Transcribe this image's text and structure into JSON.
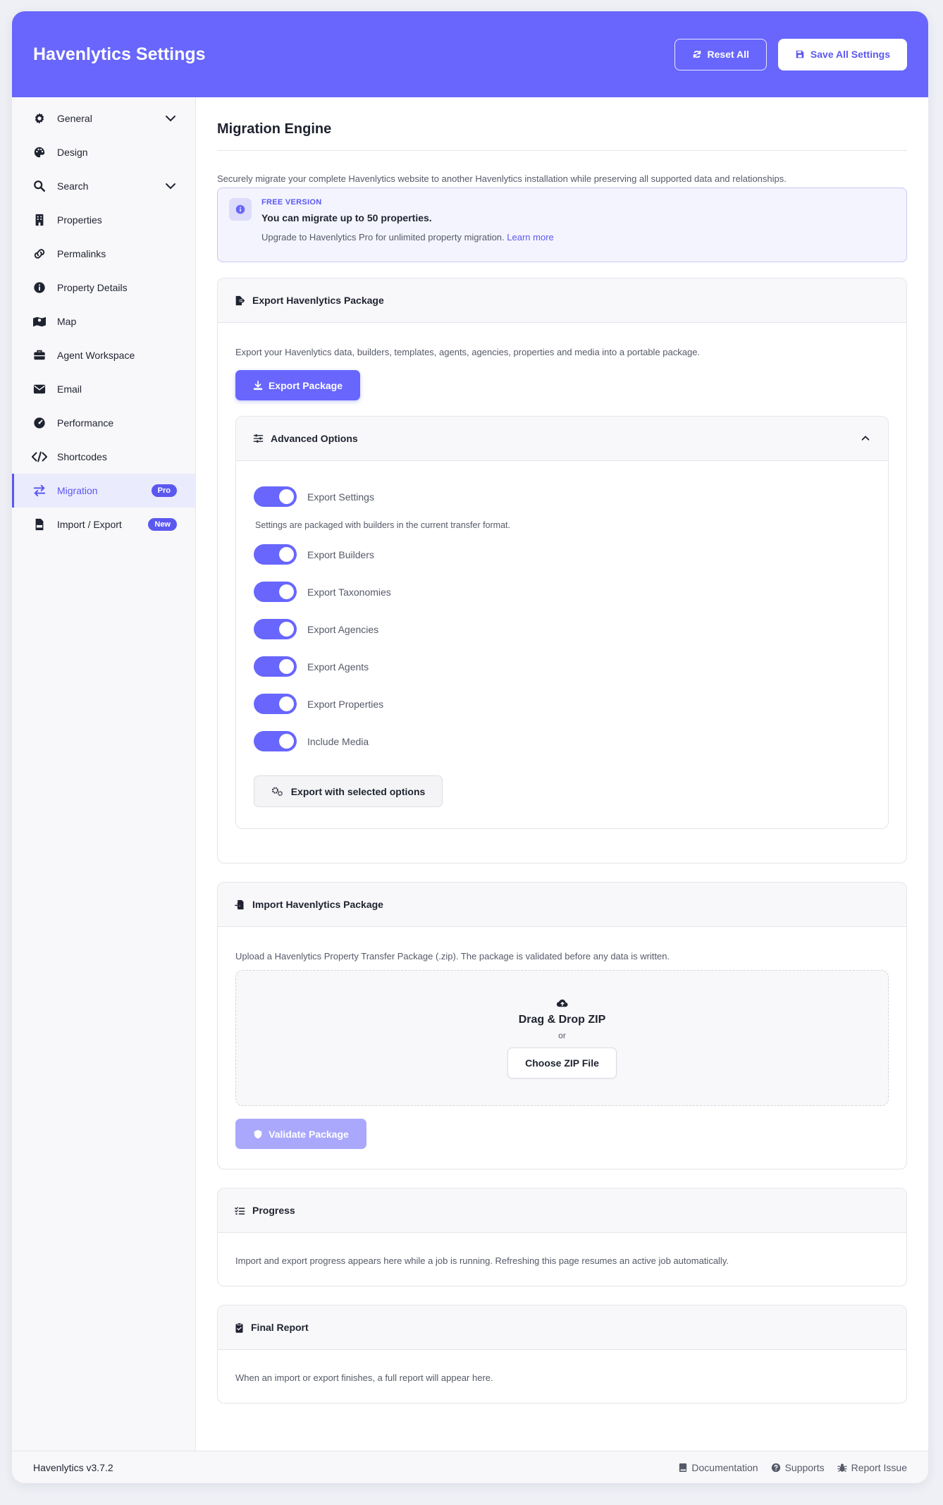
{
  "header": {
    "title": "Havenlytics Settings",
    "reset_label": "Reset All",
    "save_label": "Save All Settings"
  },
  "sidebar": {
    "items": [
      {
        "label": "General",
        "icon": "gear-icon",
        "chevron": true
      },
      {
        "label": "Design",
        "icon": "palette-icon"
      },
      {
        "label": "Search",
        "icon": "search-icon",
        "chevron": true
      },
      {
        "label": "Properties",
        "icon": "building-icon"
      },
      {
        "label": "Permalinks",
        "icon": "link-icon"
      },
      {
        "label": "Property Details",
        "icon": "info-icon"
      },
      {
        "label": "Map",
        "icon": "map-icon"
      },
      {
        "label": "Agent Workspace",
        "icon": "briefcase-icon"
      },
      {
        "label": "Email",
        "icon": "envelope-icon"
      },
      {
        "label": "Performance",
        "icon": "gauge-icon"
      },
      {
        "label": "Shortcodes",
        "icon": "code-icon"
      },
      {
        "label": "Migration",
        "icon": "arrows-swap-icon",
        "badge": "Pro",
        "active": true
      },
      {
        "label": "Import / Export",
        "icon": "csv-file-icon",
        "badge": "New"
      }
    ]
  },
  "main": {
    "title": "Migration Engine",
    "intro": "Securely migrate your complete Havenlytics website to another Havenlytics installation while preserving all supported data and relationships.",
    "notice": {
      "tag": "FREE VERSION",
      "title": "You can migrate up to 50 properties.",
      "text": "Upgrade to Havenlytics Pro for unlimited property migration.",
      "link": "Learn more"
    },
    "export": {
      "title": "Export Havenlytics Package",
      "text": "Export your Havenlytics data, builders, templates, agents, agencies, properties and media into a portable package.",
      "button": "Export Package",
      "advanced": {
        "title": "Advanced Options",
        "note": "Settings are packaged with builders in the current transfer format.",
        "toggles": [
          {
            "label": "Export Settings",
            "on": true
          },
          {
            "label": "Export Builders",
            "on": true
          },
          {
            "label": "Export Taxonomies",
            "on": true
          },
          {
            "label": "Export Agencies",
            "on": true
          },
          {
            "label": "Export Agents",
            "on": true
          },
          {
            "label": "Export Properties",
            "on": true
          },
          {
            "label": "Include Media",
            "on": true
          }
        ],
        "button": "Export with selected options"
      }
    },
    "import": {
      "title": "Import Havenlytics Package",
      "text": "Upload a Havenlytics Property Transfer Package (.zip). The package is validated before any data is written.",
      "drop_title": "Drag & Drop ZIP",
      "drop_or": "or",
      "choose_button": "Choose ZIP File",
      "validate_button": "Validate Package"
    },
    "progress": {
      "title": "Progress",
      "text": "Import and export progress appears here while a job is running. Refreshing this page resumes an active job automatically."
    },
    "report": {
      "title": "Final Report",
      "text": "When an import or export finishes, a full report will appear here."
    }
  },
  "footer": {
    "version": "Havenlytics v3.7.2",
    "links": [
      "Documentation",
      "Supports",
      "Report Issue"
    ]
  },
  "colors": {
    "accent": "#6866fd",
    "accent_dark": "#5b58f0"
  }
}
